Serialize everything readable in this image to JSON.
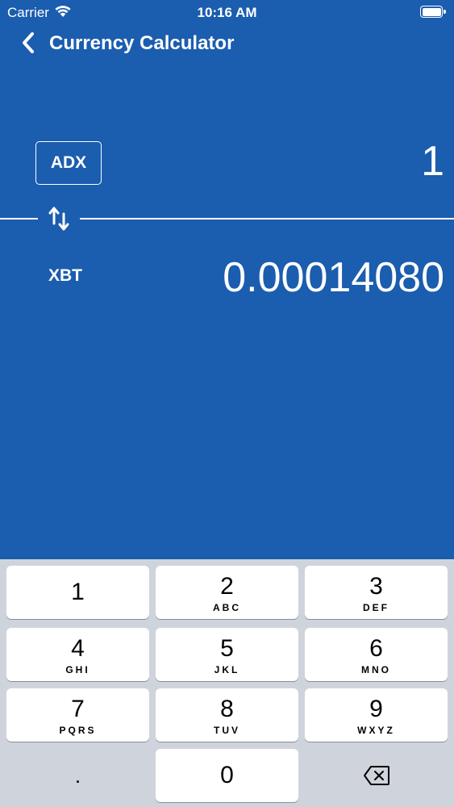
{
  "status_bar": {
    "carrier": "Carrier",
    "time": "10:16 AM",
    "icons": [
      "wifi-icon",
      "battery-icon"
    ]
  },
  "nav": {
    "back_icon": "chevron-left-icon",
    "title": "Currency Calculator"
  },
  "converter": {
    "from_currency": "ADX",
    "from_amount": "1",
    "swap_icon": "swap-vertical-arrows-icon",
    "to_currency": "XBT",
    "to_amount": "0.00014080"
  },
  "keypad": {
    "keys": [
      {
        "digit": "1",
        "letters": ""
      },
      {
        "digit": "2",
        "letters": "ABC"
      },
      {
        "digit": "3",
        "letters": "DEF"
      },
      {
        "digit": "4",
        "letters": "GHI"
      },
      {
        "digit": "5",
        "letters": "JKL"
      },
      {
        "digit": "6",
        "letters": "MNO"
      },
      {
        "digit": "7",
        "letters": "PQRS"
      },
      {
        "digit": "8",
        "letters": "TUV"
      },
      {
        "digit": "9",
        "letters": "WXYZ"
      },
      {
        "digit": ".",
        "letters": ""
      },
      {
        "digit": "0",
        "letters": ""
      }
    ],
    "delete_icon": "backspace-icon"
  },
  "colors": {
    "background": "#1b5daf",
    "keypad_background": "#cfd4dc",
    "key_background": "#ffffff"
  }
}
